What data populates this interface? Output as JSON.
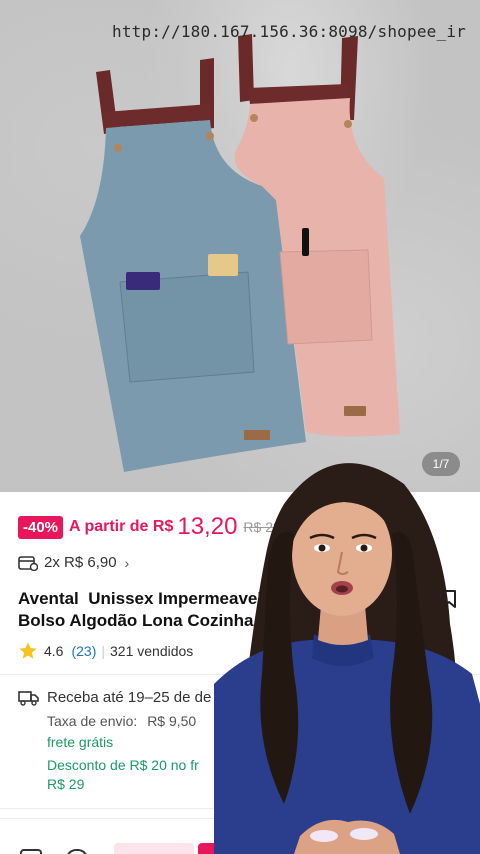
{
  "product_image": {
    "url_overlay": "http://180.167.156.36:8098/shopee_ir",
    "counter": "1/7"
  },
  "price": {
    "discount": "-40%",
    "prefix": "A partir de R$",
    "value": "13,20",
    "old": "R$ 22"
  },
  "installments": {
    "text": "2x R$ 6,90",
    "chevron": "›"
  },
  "title": {
    "line1": "Avental  Unissex Impermeavel",
    "line2": "Bolso Algodão Lona Cozinha C"
  },
  "rating": {
    "score": "4.6",
    "count": "(23)",
    "sold": "321 vendidos"
  },
  "shipping": {
    "delivery": "Receba até 19–25 de de",
    "fee_label": "Taxa de envio:",
    "fee_value": "R$ 9,50",
    "free": "frete grátis",
    "discount_line": "Desconto de R$ 20 no fr",
    "min_value": "R$ 29"
  },
  "icons": [
    "calendar-icon",
    "bookmark-icon",
    "star-icon",
    "truck-icon",
    "store-icon",
    "chat-icon"
  ],
  "colors": {
    "accent": "#e8165b",
    "rating_link": "#1a74c9",
    "free_shipping": "#1a9c67",
    "star": "#f7c325"
  }
}
